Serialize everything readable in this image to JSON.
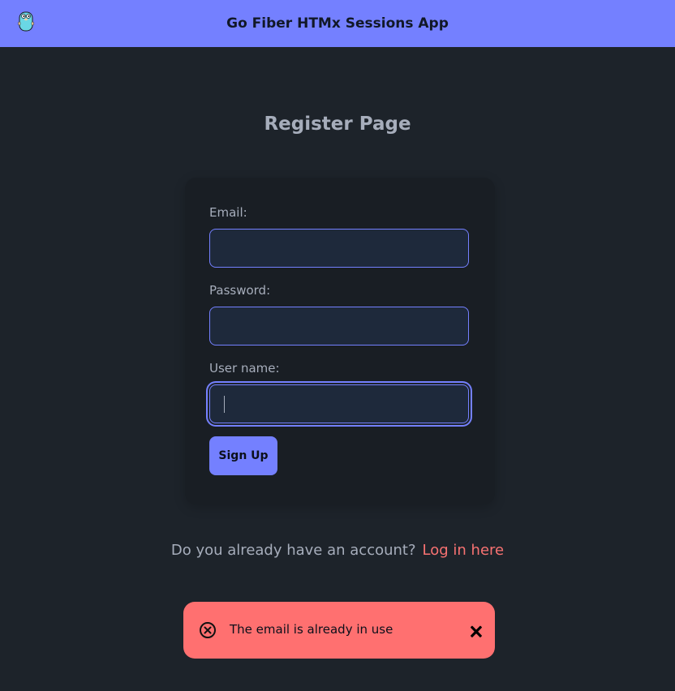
{
  "theme": {
    "primary": "#7480ff",
    "error": "#ff7070",
    "background": "#1d232a",
    "card": "#191e24"
  },
  "navbar": {
    "title": "Go Fiber HTMx Sessions App",
    "logo_icon": "gopher-icon"
  },
  "page": {
    "title": "Register Page"
  },
  "form": {
    "email": {
      "label": "Email:",
      "value": ""
    },
    "password": {
      "label": "Password:",
      "value": ""
    },
    "username": {
      "label": "User name:",
      "value": ""
    },
    "submit_label": "Sign Up"
  },
  "account_prompt": {
    "text": "Do you already have an account?",
    "link_label": "Log in here"
  },
  "toast": {
    "message": "The email is already in use",
    "icon": "error-circle-icon",
    "close_label": "🗙"
  }
}
